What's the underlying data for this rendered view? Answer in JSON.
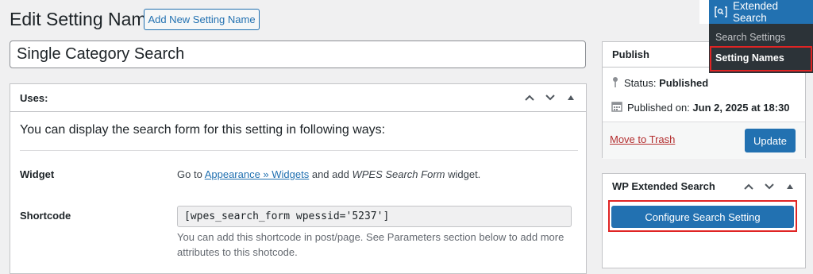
{
  "page": {
    "title": "Edit Setting Name",
    "add_new_label": "Add New Setting Name",
    "title_value": "Single Category Search"
  },
  "uses_box": {
    "heading": "Uses:",
    "intro": "You can display the search form for this setting in following ways:",
    "widget": {
      "label": "Widget",
      "text_before": "Go to ",
      "link": "Appearance » Widgets",
      "text_middle": " and add ",
      "widget_name": "WPES Search Form",
      "text_after": " widget."
    },
    "shortcode": {
      "label": "Shortcode",
      "value": "[wpes_search_form wpessid='5237']",
      "help_line1": "You can add this shortcode in post/page. See Parameters section below to add more",
      "help_line2": "attributes to this shotcode."
    }
  },
  "publish_box": {
    "heading": "Publish",
    "status_label": "Status: ",
    "status_value": "Published",
    "published_label": "Published on: ",
    "published_value": "Jun 2, 2025 at 18:30",
    "trash_label": "Move to Trash",
    "update_label": "Update"
  },
  "wpes_box": {
    "heading": "WP Extended Search",
    "configure_label": "Configure Search Setting"
  },
  "admin_menu": {
    "title": "Extended Search",
    "items": [
      "Search Settings",
      "Setting Names"
    ],
    "active_item": "Setting Names"
  },
  "colors": {
    "accent": "#2271b1",
    "highlight": "#e02424",
    "trash": "#b32d2e",
    "menu_bg": "#2c3338"
  },
  "icons": [
    "chevron-up-icon",
    "chevron-down-icon",
    "triangle-up-icon",
    "pin-icon",
    "calendar-icon",
    "search-icon"
  ]
}
